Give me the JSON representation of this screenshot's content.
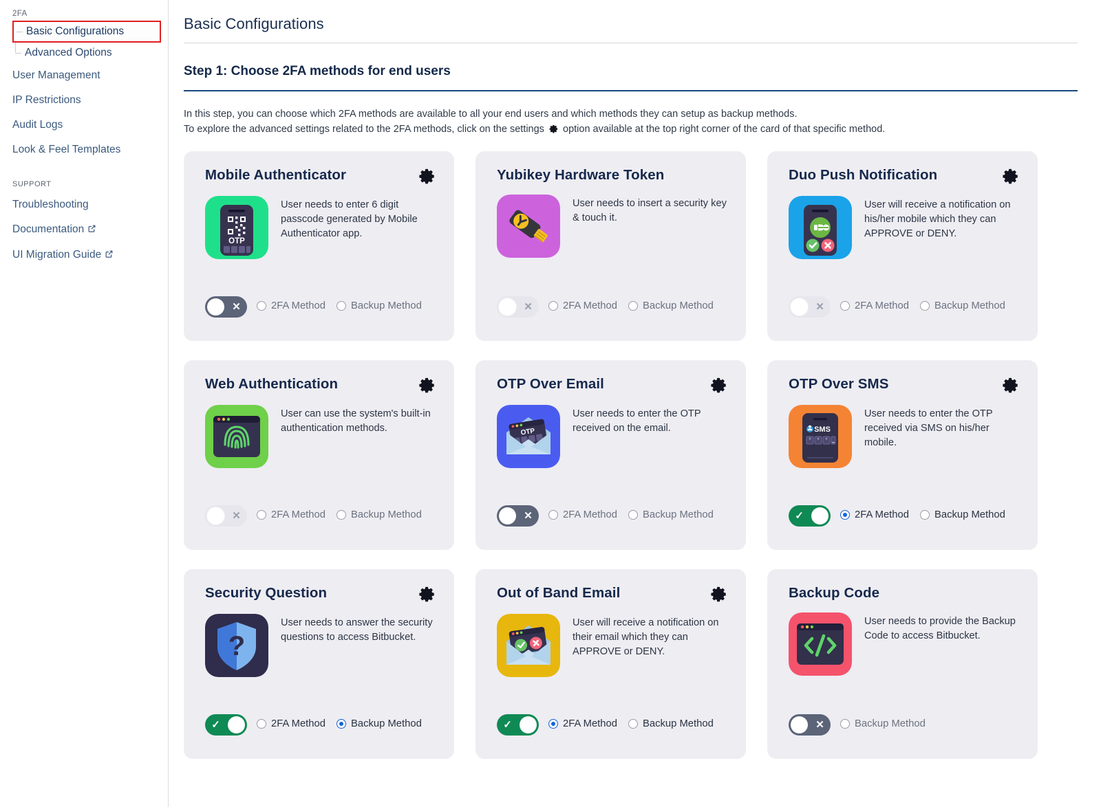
{
  "sidebar": {
    "section_2fa": "2FA",
    "tree": [
      {
        "label": "Basic Configurations",
        "selected": true
      },
      {
        "label": "Advanced Options",
        "selected": false
      }
    ],
    "nav": [
      {
        "label": "User Management",
        "external": false
      },
      {
        "label": "IP Restrictions",
        "external": false
      },
      {
        "label": "Audit Logs",
        "external": false
      },
      {
        "label": "Look & Feel Templates",
        "external": false
      }
    ],
    "section_support": "SUPPORT",
    "support": [
      {
        "label": "Troubleshooting",
        "external": false
      },
      {
        "label": "Documentation",
        "external": true
      },
      {
        "label": "UI Migration Guide",
        "external": true
      }
    ]
  },
  "header": {
    "page_title": "Basic Configurations",
    "step_title": "Step 1: Choose 2FA methods for end users",
    "intro_line1": "In this step, you can choose which 2FA methods are available to all your end users and which methods they can setup as backup methods.",
    "intro_line2_a": "To explore the advanced settings related to the 2FA methods, click on the settings",
    "intro_line2_b": "option available at the top right corner of the card of that specific method."
  },
  "labels": {
    "twofa_method": "2FA Method",
    "backup_method": "Backup Method"
  },
  "colors": {
    "accent_blue": "#1565d8",
    "toggle_on_green": "#0f8a55",
    "toggle_off_gray": "#5c6478",
    "toggle_disabled": "#e6e6ec",
    "card_bg": "#eeedf2",
    "title_navy": "#16294c",
    "highlight_red": "#e02020"
  },
  "cards": [
    {
      "title": "Mobile Authenticator",
      "description": "User needs to enter 6 digit passcode generated by Mobile Authenticator app.",
      "icon": "mobile-authenticator-icon",
      "has_gear": true,
      "toggle_state": "off",
      "radios": [
        {
          "label": "2FA Method",
          "selected": false,
          "disabled": true
        },
        {
          "label": "Backup Method",
          "selected": false,
          "disabled": true
        }
      ]
    },
    {
      "title": "Yubikey Hardware Token",
      "description": "User needs to insert a security key & touch it.",
      "icon": "yubikey-icon",
      "has_gear": false,
      "toggle_state": "disabled",
      "radios": [
        {
          "label": "2FA Method",
          "selected": false,
          "disabled": true
        },
        {
          "label": "Backup Method",
          "selected": false,
          "disabled": true
        }
      ]
    },
    {
      "title": "Duo Push Notification",
      "description": "User will receive a notification on his/her mobile which they can APPROVE or DENY.",
      "icon": "duo-push-icon",
      "has_gear": true,
      "toggle_state": "disabled",
      "radios": [
        {
          "label": "2FA Method",
          "selected": false,
          "disabled": true
        },
        {
          "label": "Backup Method",
          "selected": false,
          "disabled": true
        }
      ]
    },
    {
      "title": "Web Authentication",
      "description": "User can use the system's built-in authentication methods.",
      "icon": "web-authentication-icon",
      "has_gear": true,
      "toggle_state": "disabled",
      "radios": [
        {
          "label": "2FA Method",
          "selected": false,
          "disabled": true
        },
        {
          "label": "Backup Method",
          "selected": false,
          "disabled": true
        }
      ]
    },
    {
      "title": "OTP Over Email",
      "description": "User needs to enter the OTP received on the email.",
      "icon": "otp-over-email-icon",
      "has_gear": true,
      "toggle_state": "off",
      "radios": [
        {
          "label": "2FA Method",
          "selected": false,
          "disabled": true
        },
        {
          "label": "Backup Method",
          "selected": false,
          "disabled": true
        }
      ]
    },
    {
      "title": "OTP Over SMS",
      "description": "User needs to enter the OTP received via SMS on his/her mobile.",
      "icon": "otp-over-sms-icon",
      "has_gear": true,
      "toggle_state": "on",
      "radios": [
        {
          "label": "2FA Method",
          "selected": true,
          "disabled": false
        },
        {
          "label": "Backup Method",
          "selected": false,
          "disabled": false
        }
      ]
    },
    {
      "title": "Security Question",
      "description": "User needs to answer the security questions to access Bitbucket.",
      "icon": "security-question-icon",
      "has_gear": true,
      "toggle_state": "on",
      "radios": [
        {
          "label": "2FA Method",
          "selected": false,
          "disabled": false
        },
        {
          "label": "Backup Method",
          "selected": true,
          "disabled": false
        }
      ]
    },
    {
      "title": "Out of Band Email",
      "description": "User will receive a notification on their email which they can APPROVE or DENY.",
      "icon": "out-of-band-email-icon",
      "has_gear": true,
      "toggle_state": "on",
      "radios": [
        {
          "label": "2FA Method",
          "selected": true,
          "disabled": false
        },
        {
          "label": "Backup Method",
          "selected": false,
          "disabled": false
        }
      ]
    },
    {
      "title": "Backup Code",
      "description": "User needs to provide the Backup Code to access Bitbucket.",
      "icon": "backup-code-icon",
      "has_gear": false,
      "toggle_state": "off",
      "radios": [
        {
          "label": "Backup Method",
          "selected": false,
          "disabled": true
        }
      ]
    }
  ]
}
